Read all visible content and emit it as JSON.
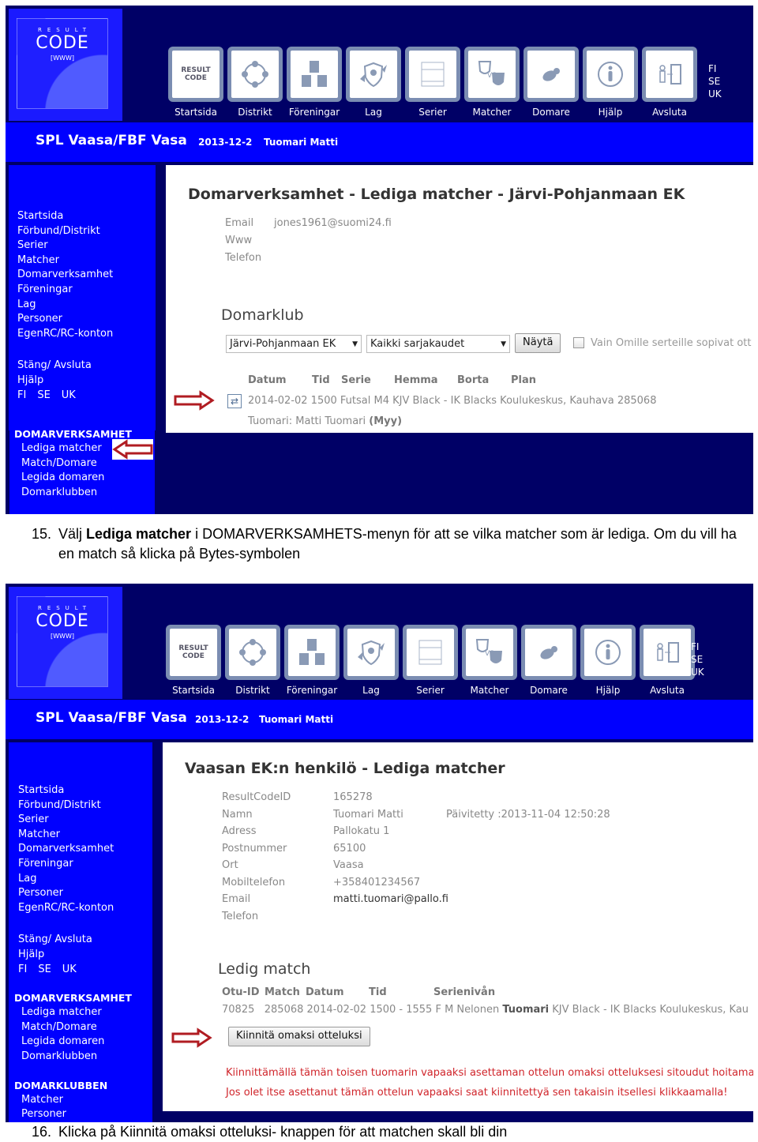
{
  "logo": {
    "result": "RESULT",
    "code": "CODE",
    "www": "[WWW]"
  },
  "nav": [
    {
      "label": "Startsida",
      "icon": "resultcode-icon"
    },
    {
      "label": "Distrikt",
      "icon": "district-people-icon"
    },
    {
      "label": "Föreningar",
      "icon": "clubs-icon"
    },
    {
      "label": "Lag",
      "icon": "team-shield-icon"
    },
    {
      "label": "Serier",
      "icon": "series-table-icon"
    },
    {
      "label": "Matcher",
      "icon": "versus-shields-icon"
    },
    {
      "label": "Domare",
      "icon": "whistle-icon"
    },
    {
      "label": "Hjälp",
      "icon": "info-icon"
    },
    {
      "label": "Avsluta",
      "icon": "exit-door-icon"
    }
  ],
  "languages": [
    "FI",
    "SE",
    "UK"
  ],
  "titlebar": {
    "org": "SPL Vaasa/FBF Vasa",
    "date": "2013-12-2",
    "user": "Tuomari Matti"
  },
  "sidebar": {
    "main": [
      "Startsida",
      "Förbund/Distrikt",
      "Serier",
      "Matcher",
      "Domarverksamhet",
      "Föreningar",
      "Lag",
      "Personer",
      "EgenRC/RC-konton"
    ],
    "utility": [
      "Stäng/ Avsluta",
      "Hjälp"
    ],
    "domarverksamhet": {
      "heading": "DOMARVERKSAMHET",
      "items": [
        "Lediga matcher",
        "Match/Domare",
        "Legida domaren",
        "Domarklubben"
      ]
    },
    "domarklubben": {
      "heading": "DOMARKLUBBEN",
      "items": [
        "Matcher",
        "Personer"
      ]
    }
  },
  "screen1": {
    "title": "Domarverksamhet - Lediga matcher - Järvi-Pohjanmaan EK",
    "contact": [
      {
        "label": "Email",
        "value": "jones1961@suomi24.fi"
      },
      {
        "label": "Www",
        "value": ""
      },
      {
        "label": "Telefon",
        "value": ""
      }
    ],
    "section": "Domarklub",
    "club_select": "Järvi-Pohjanmaan EK",
    "season_select": "Kaikki sarjakaudet",
    "show_button": "Näytä",
    "checkbox_label": "Vain Omille serteille sopivat ott",
    "checkbox_checked": false,
    "columns": [
      "Datum",
      "Tid",
      "Serie",
      "Hemma",
      "Borta",
      "Plan"
    ],
    "match_row": "2014-02-02 1500 Futsal M4 KJV Black - IK Blacks Koulukeskus, Kauhava 285068",
    "referee_prefix": "Tuomari: Matti Tuomari",
    "referee_role": "(Myy)"
  },
  "caption1": {
    "number": "15.",
    "pre": "Välj ",
    "bold": "Lediga matcher",
    "post": " i DOMARVERKSAMHETS-menyn för att se vilka matcher som är lediga. Om du vill ha en match så klicka på Bytes-symbolen"
  },
  "screen2": {
    "title": "Vaasan EK:n henkilö - Lediga matcher",
    "person": [
      {
        "label": "ResultCodeID",
        "value": "165278"
      },
      {
        "label": "Namn",
        "value": "Tuomari Matti"
      },
      {
        "label": "Adress",
        "value": "Pallokatu 1"
      },
      {
        "label": "Postnummer",
        "value": "65100"
      },
      {
        "label": "Ort",
        "value": "Vaasa"
      },
      {
        "label": "Mobiltelefon",
        "value": "+358401234567"
      },
      {
        "label": "Email",
        "value": "matti.tuomari@pallo.fi"
      },
      {
        "label": "Telefon",
        "value": ""
      }
    ],
    "updated": "Päivitetty :2013-11-04 12:50:28",
    "section": "Ledig match",
    "columns": [
      "Otu-ID",
      "Match",
      "Datum",
      "Tid",
      "Serienivån"
    ],
    "row": {
      "otu_id": "70825",
      "rest": "285068 2014-02-02 1500 - 1555 F M Nelonen",
      "role": "Tuomari",
      "teams": "KJV Black - IK Blacks Koulukeskus, Kau"
    },
    "claim_button": "Kiinnitä omaksi otteluksi",
    "warning1": "Kiinnittämällä tämän toisen tuomarin vapaaksi asettaman ottelun omaksi otteluksesi sitoudut hoitamaa",
    "warning2": "Jos olet itse asettanut tämän ottelun vapaaksi saat kiinnitettyä sen takaisin itsellesi klikkaamalla!"
  },
  "caption2": {
    "number": "16.",
    "text": "Klicka på Kiinnitä omaksi otteluksi- knappen för att matchen skall bli din"
  }
}
